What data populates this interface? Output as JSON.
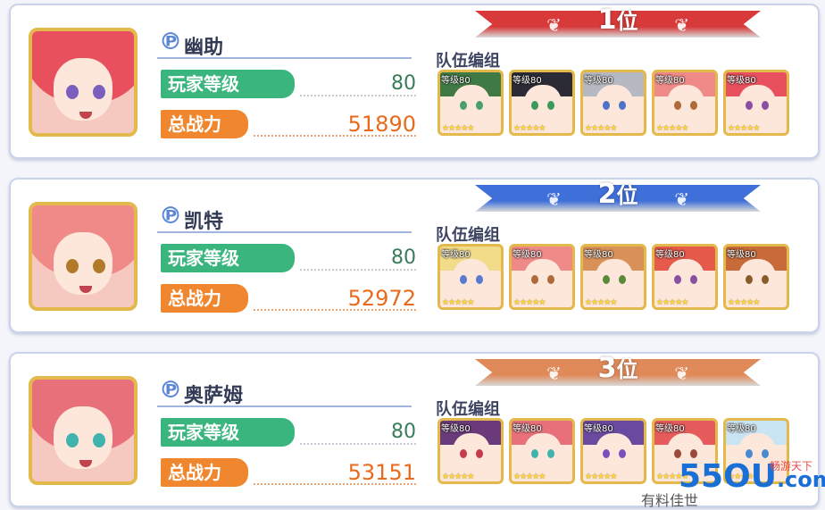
{
  "players": [
    {
      "rank": "1",
      "rank_suffix": "位",
      "rank_color": "#d83a3a",
      "name": "幽助",
      "level_label": "玩家等级",
      "level": "80",
      "power_label": "总战力",
      "power": "51890",
      "team_label": "队伍编组",
      "hair_color": "#e8505e",
      "eye_color": "#7a5fbf",
      "team": [
        {
          "level": "等级80",
          "hair": "#3f7a45",
          "eye": "#4ca06a",
          "stars": "★★★★★"
        },
        {
          "level": "等级80",
          "hair": "#2b2b35",
          "eye": "#3a9a5a",
          "stars": "★★★★★"
        },
        {
          "level": "等级80",
          "hair": "#b7b9c2",
          "eye": "#4e73c9",
          "stars": "★★★★★"
        },
        {
          "level": "等级80",
          "hair": "#f08a88",
          "eye": "#b06a3a",
          "stars": "★★★★★"
        },
        {
          "level": "等级80",
          "hair": "#e8505e",
          "eye": "#8a4fa0",
          "stars": "★★★★★"
        }
      ]
    },
    {
      "rank": "2",
      "rank_suffix": "位",
      "rank_color": "#3f6fd8",
      "name": "凯特",
      "level_label": "玩家等级",
      "level": "80",
      "power_label": "总战力",
      "power": "52972",
      "team_label": "队伍编组",
      "hair_color": "#f08a88",
      "eye_color": "#b07a2a",
      "team": [
        {
          "level": "等级80",
          "hair": "#f2dc8a",
          "eye": "#5a7ad0",
          "stars": "★★★★★"
        },
        {
          "level": "等级80",
          "hair": "#f08a88",
          "eye": "#b06a3a",
          "stars": "★★★★★"
        },
        {
          "level": "等级80",
          "hair": "#d9915a",
          "eye": "#5a8a3a",
          "stars": "★★★★★"
        },
        {
          "level": "等级80",
          "hair": "#e55a4a",
          "eye": "#8a4fa0",
          "stars": "★★★★★"
        },
        {
          "level": "等级80",
          "hair": "#c86a3a",
          "eye": "#8a5a2a",
          "stars": "★★★★★"
        }
      ]
    },
    {
      "rank": "3",
      "rank_suffix": "位",
      "rank_color": "#e08a5a",
      "name": "奥萨姆",
      "level_label": "玩家等级",
      "level": "80",
      "power_label": "总战力",
      "power": "53151",
      "team_label": "队伍编组",
      "hair_color": "#e8707a",
      "eye_color": "#3fb3b0",
      "team": [
        {
          "level": "等级80",
          "hair": "#6a3a7a",
          "eye": "#c63a4a",
          "stars": "★★★★★"
        },
        {
          "level": "等级80",
          "hair": "#e8707a",
          "eye": "#3fb3b0",
          "stars": "★★★★★"
        },
        {
          "level": "等级80",
          "hair": "#6a4aa0",
          "eye": "#7a4fc0",
          "stars": "★★★★★"
        },
        {
          "level": "等级80",
          "hair": "#e55a5a",
          "eye": "#9a4a3a",
          "stars": "★★★★★"
        },
        {
          "level": "等级80",
          "hair": "#c9e4f2",
          "eye": "#4a8ad0",
          "stars": "★★★★★"
        }
      ]
    }
  ],
  "watermark": {
    "main": "55OU",
    "domain": ".com",
    "sub": "有料佳世",
    "tag": "畅游天下"
  }
}
